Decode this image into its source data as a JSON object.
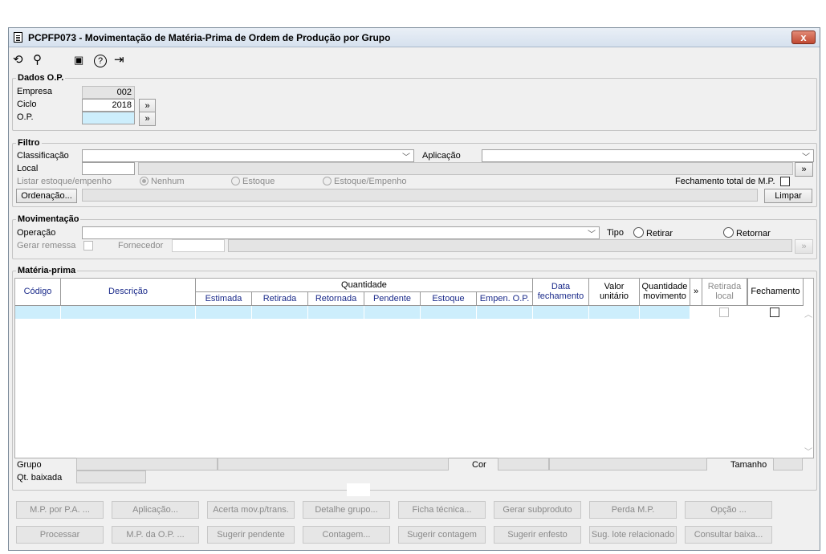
{
  "window": {
    "title": "PCPFP073 - Movimentação de Matéria-Prima de Ordem de Produção por Grupo",
    "close": "x"
  },
  "toolbar": {
    "undo": "⟲",
    "search": "⚲",
    "calendar": "▣",
    "help": "?",
    "exit": "⇥"
  },
  "dados": {
    "legend": "Dados O.P.",
    "empresa_label": "Empresa",
    "empresa_value": "002",
    "ciclo_label": "Ciclo",
    "ciclo_value": "2018",
    "op_label": "O.P.",
    "op_value": "",
    "more": "»"
  },
  "filtro": {
    "legend": "Filtro",
    "classificacao_label": "Classificação",
    "aplicacao_label": "Aplicação",
    "local_label": "Local",
    "listar_label": "Listar estoque/empenho",
    "opt_nenhum": "Nenhum",
    "opt_estoque": "Estoque",
    "opt_estoque_empenho": "Estoque/Empenho",
    "fechamento_total_label": "Fechamento total de M.P.",
    "ordenacao_btn": "Ordenação...",
    "limpar_btn": "Limpar",
    "more": "»"
  },
  "mov": {
    "legend": "Movimentação",
    "operacao_label": "Operação",
    "tipo_label": "Tipo",
    "retirar": "Retirar",
    "retornar": "Retornar",
    "gerar_remessa": "Gerar remessa",
    "fornecedor": "Fornecedor",
    "more": "»"
  },
  "mp": {
    "legend": "Matéria-prima",
    "headers": {
      "codigo": "Código",
      "descricao": "Descrição",
      "quantidade": "Quantidade",
      "estimada": "Estimada",
      "retirada": "Retirada",
      "retornada": "Retornada",
      "pendente": "Pendente",
      "estoque": "Estoque",
      "empen": "Empen. O.P.",
      "data1": "Data",
      "data2": "fechamento",
      "valor1": "Valor",
      "valor2": "unitário",
      "qtmov1": "Quantidade",
      "qtmov2": "movimento",
      "more": "»",
      "retl1": "Retirada",
      "retl2": "local",
      "fechamento": "Fechamento"
    },
    "grupo_label": "Grupo",
    "cor_label": "Cor",
    "tamanho_label": "Tamanho",
    "qtbaixada_label": "Qt. baixada"
  },
  "buttons_row1": [
    "M.P. por P.A. ...",
    "Aplicação...",
    "Acerta mov.p/trans.",
    "Detalhe grupo...",
    "Ficha técnica...",
    "Gerar subproduto",
    "Perda M.P.",
    "Opção ..."
  ],
  "buttons_row2": [
    "Processar",
    "M.P. da O.P. ...",
    "Sugerir pendente",
    "Contagem...",
    "Sugerir contagem",
    "Sugerir enfesto",
    "Sug. lote relacionado",
    "Consultar baixa..."
  ]
}
